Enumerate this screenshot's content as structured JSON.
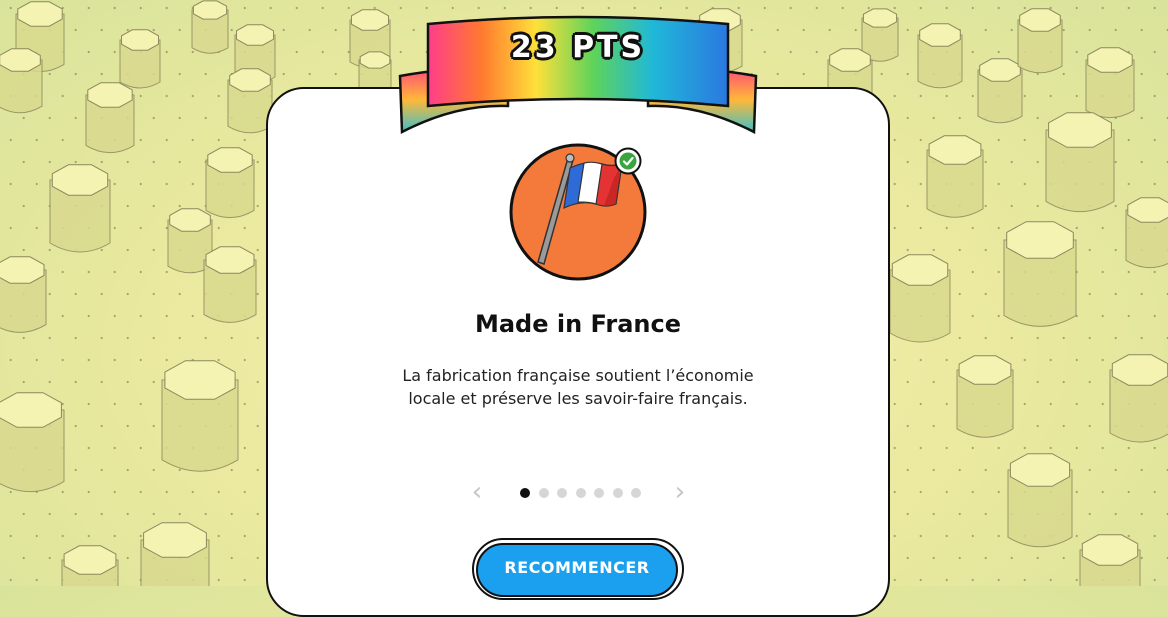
{
  "score": {
    "label": "23 PTS"
  },
  "achievement": {
    "icon": "french-flag-icon",
    "status_icon": "check-icon",
    "title": "Made in France",
    "description_line1": "La fabrication française soutient l’économie",
    "description_line2": "locale et préserve les savoir-faire français."
  },
  "pagination": {
    "total": 7,
    "current": 1
  },
  "actions": {
    "restart_label": "RECOMMENCER"
  },
  "colors": {
    "badge_background": "#f47a3c",
    "button_background": "#1aa0ee",
    "check_green": "#3aa53f",
    "flag_blue": "#2e6bd6",
    "flag_red": "#e53232"
  }
}
